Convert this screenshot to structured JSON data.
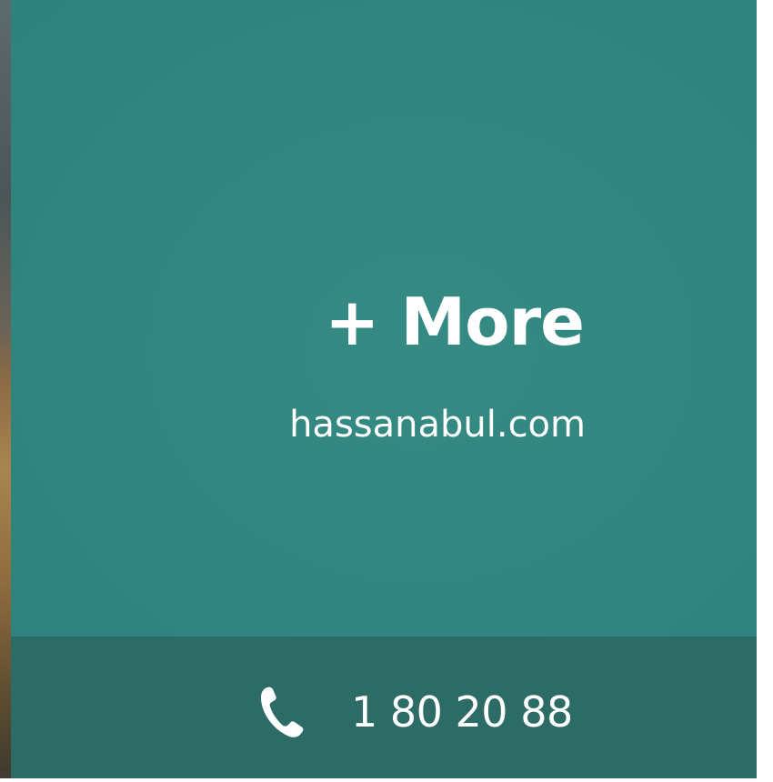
{
  "heading": {
    "text": "+ More"
  },
  "website": {
    "text": "hassanabul.com"
  },
  "contact": {
    "icon": "phone-icon",
    "phone": "1 80 20 88"
  },
  "colors": {
    "panel": "#328680",
    "bottom_bar": "#2d6c66",
    "text": "#ffffff"
  }
}
